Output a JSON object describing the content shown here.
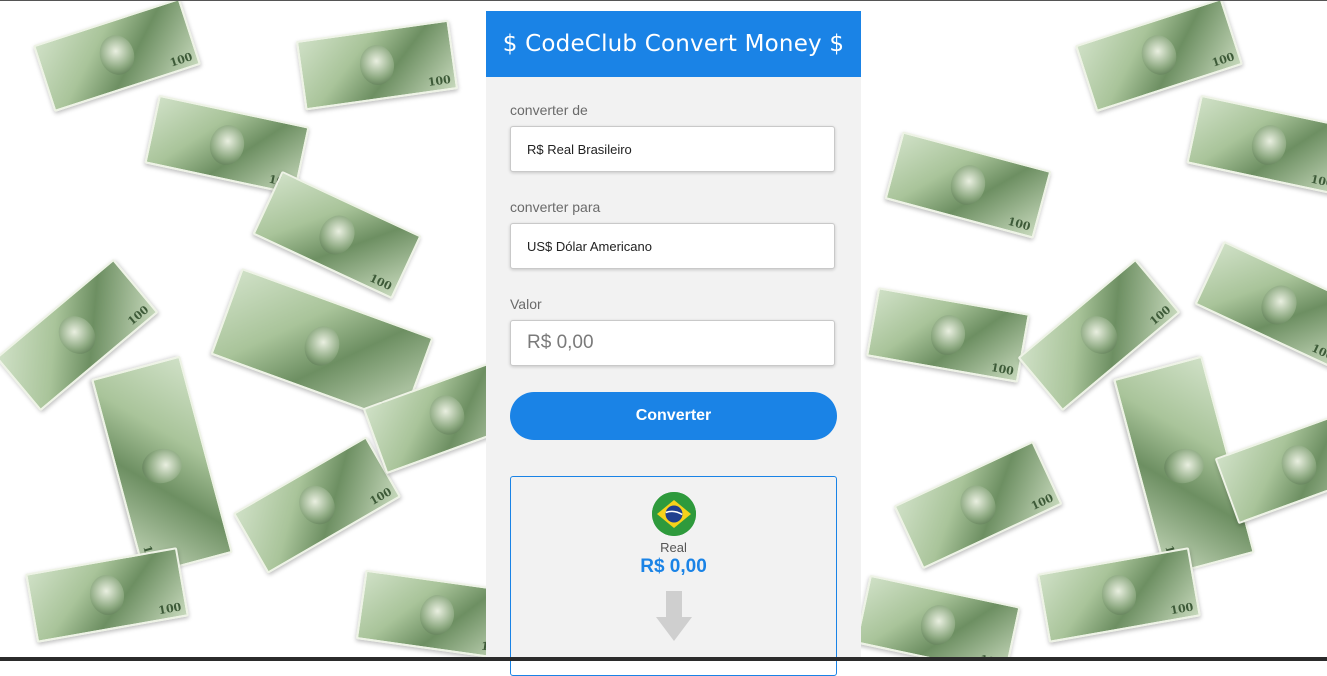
{
  "header": {
    "title": "$ CodeClub Convert Money $"
  },
  "from": {
    "label": "converter de",
    "value": "R$ Real Brasileiro"
  },
  "to": {
    "label": "converter para",
    "value": "US$ Dólar Americano"
  },
  "amount": {
    "label": "Valor",
    "placeholder": "R$ 0,00"
  },
  "convert_button": {
    "label": "Converter"
  },
  "result": {
    "flag_icon": "brazil-flag-icon",
    "currency_name": "Real",
    "currency_value": "R$ 0,00",
    "arrow_icon": "arrow-down-icon"
  },
  "colors": {
    "accent": "#1a83e6",
    "panel_bg": "#f2f2f2"
  }
}
